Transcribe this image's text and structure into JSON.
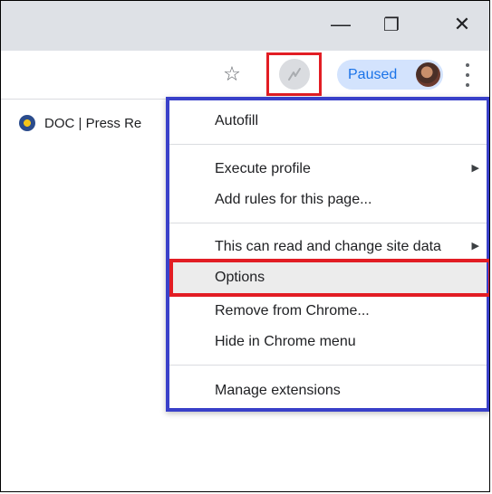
{
  "window": {
    "minimize_glyph": "—",
    "restore_glyph": "❐",
    "close_glyph": "✕"
  },
  "toolbar": {
    "star_glyph": "☆",
    "profile_label": "Paused"
  },
  "bookmark": {
    "label": "DOC | Press Re"
  },
  "menu": {
    "items": [
      {
        "label": "Autofill"
      },
      {
        "label": "Execute profile",
        "submenu": "▶"
      },
      {
        "label": "Add rules for this page..."
      },
      {
        "label": "This can read and change site data",
        "submenu": "▶"
      },
      {
        "label": "Options",
        "selected": true
      },
      {
        "label": "Remove from Chrome..."
      },
      {
        "label": "Hide in Chrome menu"
      },
      {
        "label": "Manage extensions"
      }
    ]
  },
  "colors": {
    "highlight_red": "#e21d24",
    "menu_outline_blue": "#3940c9",
    "profile_pill": "#d3e3fd",
    "profile_text": "#1a73e8"
  },
  "icons": [
    "star-icon",
    "extension-icon",
    "avatar",
    "kebab-menu-icon",
    "minimize-icon",
    "restore-icon",
    "close-icon",
    "commerce-seal-icon",
    "submenu-arrow-icon"
  ]
}
